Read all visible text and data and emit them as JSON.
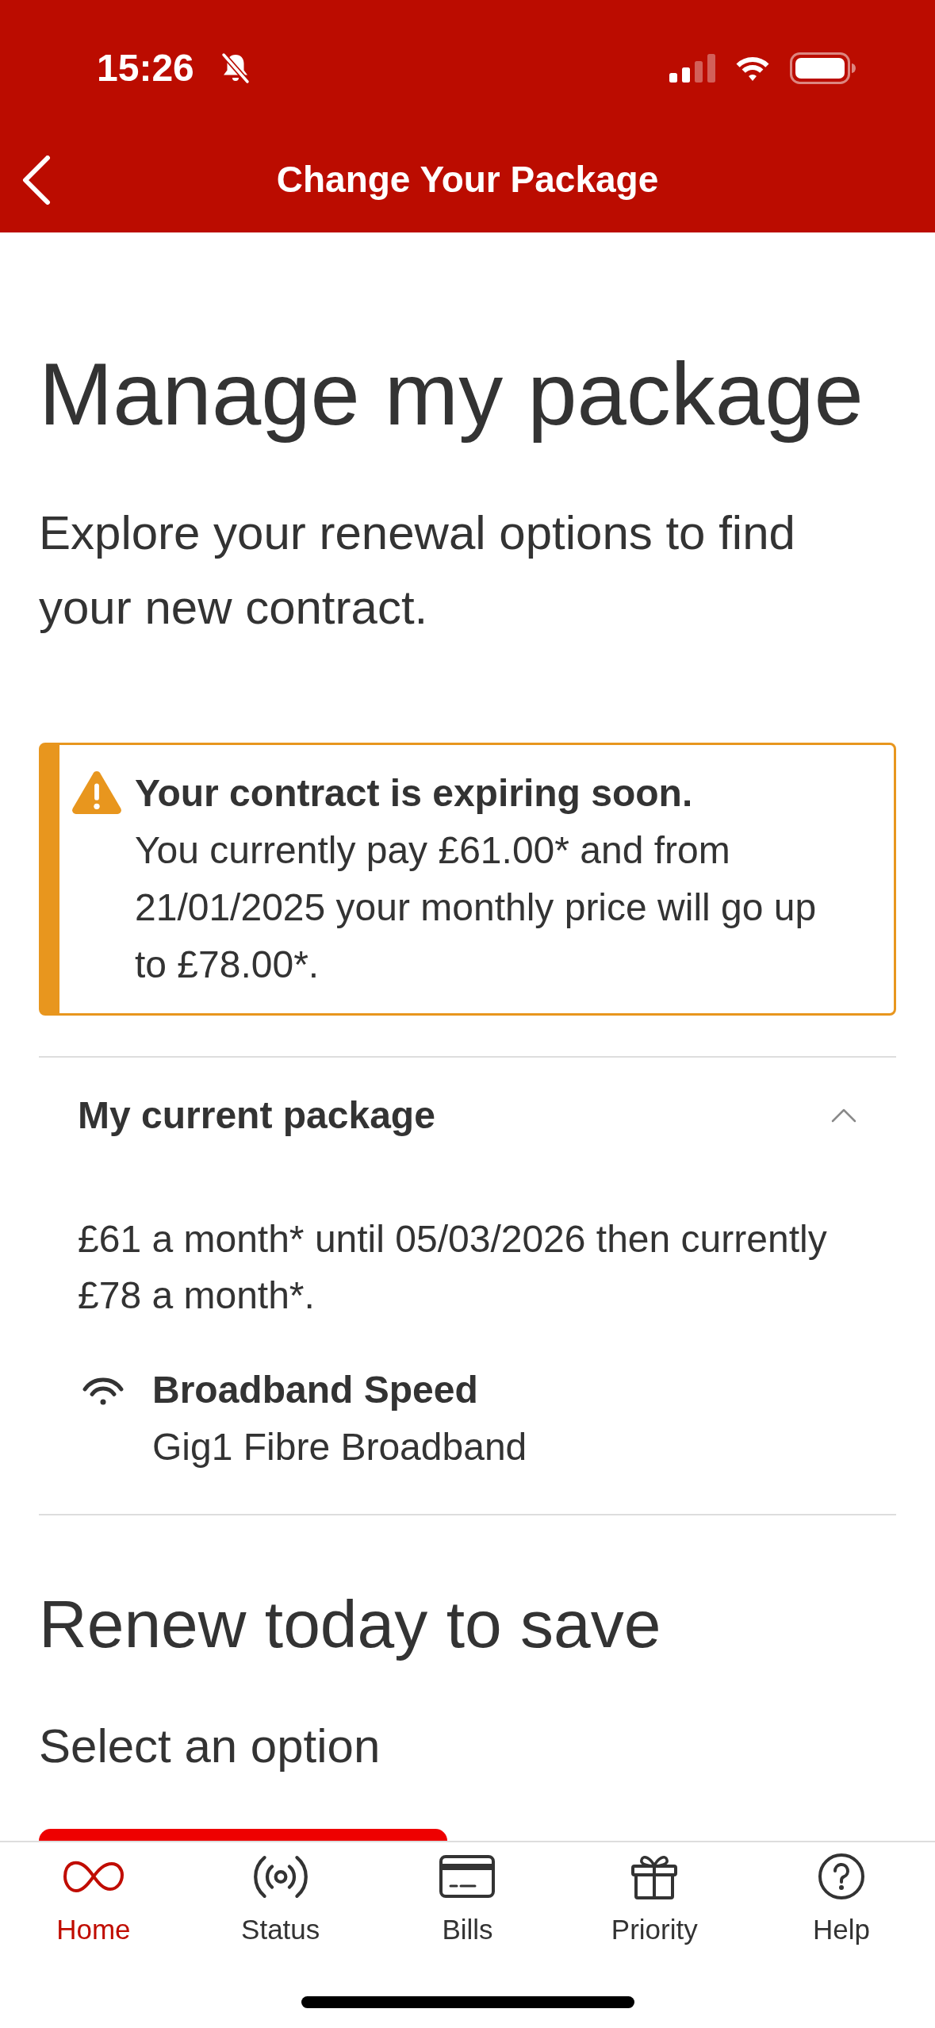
{
  "status_bar": {
    "time": "15:26"
  },
  "header": {
    "title": "Change Your Package"
  },
  "page": {
    "title": "Manage my package",
    "intro": "Explore your renewal options to find your new contract."
  },
  "alert": {
    "title": "Your contract is expiring soon.",
    "message": "You currently pay £61.00* and from 21/01/2025 your monthly price will go up to £78.00*."
  },
  "current_package": {
    "title": "My current package",
    "expanded": true,
    "summary": "£61 a month* until 05/03/2026 then currently £78 a month*.",
    "features": [
      {
        "label": "Broadband Speed",
        "value": "Gig1 Fibre Broadband"
      }
    ]
  },
  "renew": {
    "title": "Renew today to save",
    "prompt": "Select an option"
  },
  "tab_bar": [
    {
      "label": "Home",
      "selected": true
    },
    {
      "label": "Status",
      "selected": false
    },
    {
      "label": "Bills",
      "selected": false
    },
    {
      "label": "Priority",
      "selected": false
    },
    {
      "label": "Help",
      "selected": false
    }
  ]
}
